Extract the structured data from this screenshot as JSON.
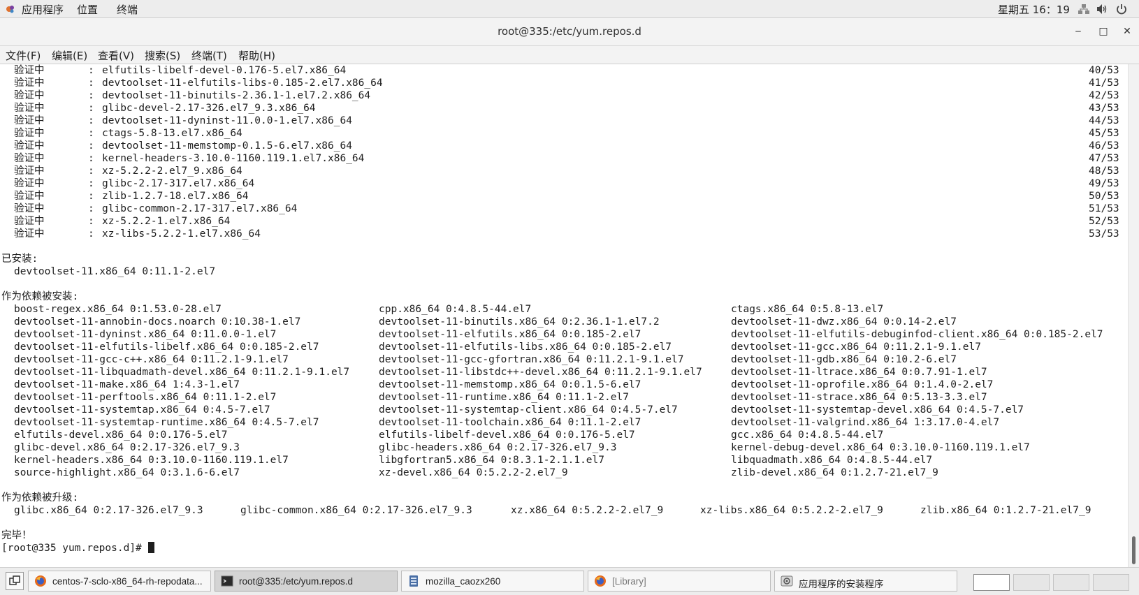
{
  "top_panel": {
    "menus": [
      "应用程序",
      "位置",
      "终端"
    ],
    "clock": "星期五 16：19"
  },
  "window": {
    "title": "root@335:/etc/yum.repos.d",
    "buttons": {
      "minimize": "‒",
      "maximize": "□",
      "close": "✕"
    }
  },
  "menubar": [
    "文件(F)",
    "编辑(E)",
    "查看(V)",
    "搜索(S)",
    "终端(T)",
    "帮助(H)"
  ],
  "terminal": {
    "verify_label": "验证中",
    "verify_lines": [
      {
        "pkg": "elfutils-libelf-devel-0.176-5.el7.x86_64",
        "count": "40/53"
      },
      {
        "pkg": "devtoolset-11-elfutils-libs-0.185-2.el7.x86_64",
        "count": "41/53"
      },
      {
        "pkg": "devtoolset-11-binutils-2.36.1-1.el7.2.x86_64",
        "count": "42/53"
      },
      {
        "pkg": "glibc-devel-2.17-326.el7_9.3.x86_64",
        "count": "43/53"
      },
      {
        "pkg": "devtoolset-11-dyninst-11.0.0-1.el7.x86_64",
        "count": "44/53"
      },
      {
        "pkg": "ctags-5.8-13.el7.x86_64",
        "count": "45/53"
      },
      {
        "pkg": "devtoolset-11-memstomp-0.1.5-6.el7.x86_64",
        "count": "46/53"
      },
      {
        "pkg": "kernel-headers-3.10.0-1160.119.1.el7.x86_64",
        "count": "47/53"
      },
      {
        "pkg": "xz-5.2.2-2.el7_9.x86_64",
        "count": "48/53"
      },
      {
        "pkg": "glibc-2.17-317.el7.x86_64",
        "count": "49/53"
      },
      {
        "pkg": "zlib-1.2.7-18.el7.x86_64",
        "count": "50/53"
      },
      {
        "pkg": "glibc-common-2.17-317.el7.x86_64",
        "count": "51/53"
      },
      {
        "pkg": "xz-5.2.2-1.el7.x86_64",
        "count": "52/53"
      },
      {
        "pkg": "xz-libs-5.2.2-1.el7.x86_64",
        "count": "53/53"
      }
    ],
    "installed_header": "已安装:",
    "installed": "devtoolset-11.x86_64 0:11.1-2.el7",
    "deps_header": "作为依赖被安装:",
    "deps": [
      [
        "boost-regex.x86_64 0:1.53.0-28.el7",
        "cpp.x86_64 0:4.8.5-44.el7",
        "ctags.x86_64 0:5.8-13.el7"
      ],
      [
        "devtoolset-11-annobin-docs.noarch 0:10.38-1.el7",
        "devtoolset-11-binutils.x86_64 0:2.36.1-1.el7.2",
        "devtoolset-11-dwz.x86_64 0:0.14-2.el7"
      ],
      [
        "devtoolset-11-dyninst.x86_64 0:11.0.0-1.el7",
        "devtoolset-11-elfutils.x86_64 0:0.185-2.el7",
        "devtoolset-11-elfutils-debuginfod-client.x86_64 0:0.185-2.el7"
      ],
      [
        "devtoolset-11-elfutils-libelf.x86_64 0:0.185-2.el7",
        "devtoolset-11-elfutils-libs.x86_64 0:0.185-2.el7",
        "devtoolset-11-gcc.x86_64 0:11.2.1-9.1.el7"
      ],
      [
        "devtoolset-11-gcc-c++.x86_64 0:11.2.1-9.1.el7",
        "devtoolset-11-gcc-gfortran.x86_64 0:11.2.1-9.1.el7",
        "devtoolset-11-gdb.x86_64 0:10.2-6.el7"
      ],
      [
        "devtoolset-11-libquadmath-devel.x86_64 0:11.2.1-9.1.el7",
        "devtoolset-11-libstdc++-devel.x86_64 0:11.2.1-9.1.el7",
        "devtoolset-11-ltrace.x86_64 0:0.7.91-1.el7"
      ],
      [
        "devtoolset-11-make.x86_64 1:4.3-1.el7",
        "devtoolset-11-memstomp.x86_64 0:0.1.5-6.el7",
        "devtoolset-11-oprofile.x86_64 0:1.4.0-2.el7"
      ],
      [
        "devtoolset-11-perftools.x86_64 0:11.1-2.el7",
        "devtoolset-11-runtime.x86_64 0:11.1-2.el7",
        "devtoolset-11-strace.x86_64 0:5.13-3.3.el7"
      ],
      [
        "devtoolset-11-systemtap.x86_64 0:4.5-7.el7",
        "devtoolset-11-systemtap-client.x86_64 0:4.5-7.el7",
        "devtoolset-11-systemtap-devel.x86_64 0:4.5-7.el7"
      ],
      [
        "devtoolset-11-systemtap-runtime.x86_64 0:4.5-7.el7",
        "devtoolset-11-toolchain.x86_64 0:11.1-2.el7",
        "devtoolset-11-valgrind.x86_64 1:3.17.0-4.el7"
      ],
      [
        "elfutils-devel.x86_64 0:0.176-5.el7",
        "elfutils-libelf-devel.x86_64 0:0.176-5.el7",
        "gcc.x86_64 0:4.8.5-44.el7"
      ],
      [
        "glibc-devel.x86_64 0:2.17-326.el7_9.3",
        "glibc-headers.x86_64 0:2.17-326.el7_9.3",
        "kernel-debug-devel.x86_64 0:3.10.0-1160.119.1.el7"
      ],
      [
        "kernel-headers.x86_64 0:3.10.0-1160.119.1.el7",
        "libgfortran5.x86_64 0:8.3.1-2.1.1.el7",
        "libquadmath.x86_64 0:4.8.5-44.el7"
      ],
      [
        "source-highlight.x86_64 0:3.1.6-6.el7",
        "xz-devel.x86_64 0:5.2.2-2.el7_9",
        "zlib-devel.x86_64 0:1.2.7-21.el7_9"
      ]
    ],
    "upgraded_header": "作为依赖被升级:",
    "upgraded": [
      "glibc.x86_64 0:2.17-326.el7_9.3",
      "glibc-common.x86_64 0:2.17-326.el7_9.3",
      "xz.x86_64 0:5.2.2-2.el7_9",
      "xz-libs.x86_64 0:5.2.2-2.el7_9",
      "zlib.x86_64 0:1.2.7-21.el7_9"
    ],
    "done": "完毕！",
    "prompt": "[root@335 yum.repos.d]# "
  },
  "taskbar": {
    "tasks": [
      {
        "label": "centos-7-sclo-x86_64-rh-repodata...",
        "icon": "firefox-icon",
        "active": false
      },
      {
        "label": "root@335:/etc/yum.repos.d",
        "icon": "terminal-icon",
        "active": true
      },
      {
        "label": "mozilla_caozx260",
        "icon": "file-manager-icon",
        "active": false
      },
      {
        "label": "[Library]",
        "icon": "firefox-icon",
        "active": false
      },
      {
        "label": "应用程序的安装程序",
        "icon": "installer-icon",
        "active": false
      }
    ]
  },
  "colors": {
    "panel_bg": "#ededed",
    "terminal_bg": "#ffffff",
    "terminal_fg": "#1e1e1e",
    "active_task_bg": "#d4d4d4"
  }
}
